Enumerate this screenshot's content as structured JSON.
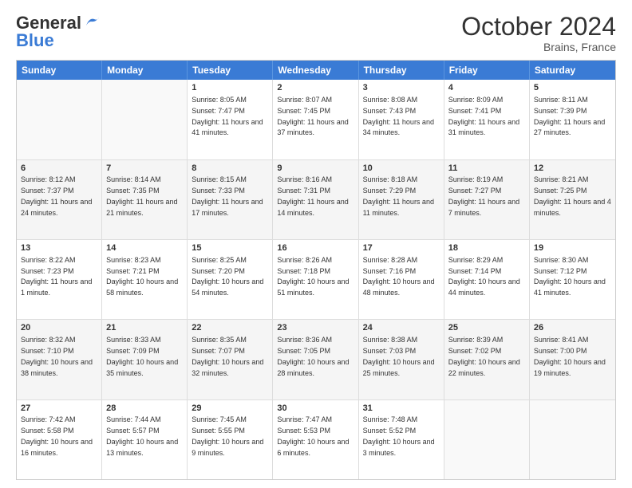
{
  "header": {
    "logo_line1": "General",
    "logo_line2": "Blue",
    "month": "October 2024",
    "location": "Brains, France"
  },
  "weekdays": [
    "Sunday",
    "Monday",
    "Tuesday",
    "Wednesday",
    "Thursday",
    "Friday",
    "Saturday"
  ],
  "rows": [
    [
      {
        "day": "",
        "text": ""
      },
      {
        "day": "",
        "text": ""
      },
      {
        "day": "1",
        "text": "Sunrise: 8:05 AM\nSunset: 7:47 PM\nDaylight: 11 hours and 41 minutes."
      },
      {
        "day": "2",
        "text": "Sunrise: 8:07 AM\nSunset: 7:45 PM\nDaylight: 11 hours and 37 minutes."
      },
      {
        "day": "3",
        "text": "Sunrise: 8:08 AM\nSunset: 7:43 PM\nDaylight: 11 hours and 34 minutes."
      },
      {
        "day": "4",
        "text": "Sunrise: 8:09 AM\nSunset: 7:41 PM\nDaylight: 11 hours and 31 minutes."
      },
      {
        "day": "5",
        "text": "Sunrise: 8:11 AM\nSunset: 7:39 PM\nDaylight: 11 hours and 27 minutes."
      }
    ],
    [
      {
        "day": "6",
        "text": "Sunrise: 8:12 AM\nSunset: 7:37 PM\nDaylight: 11 hours and 24 minutes."
      },
      {
        "day": "7",
        "text": "Sunrise: 8:14 AM\nSunset: 7:35 PM\nDaylight: 11 hours and 21 minutes."
      },
      {
        "day": "8",
        "text": "Sunrise: 8:15 AM\nSunset: 7:33 PM\nDaylight: 11 hours and 17 minutes."
      },
      {
        "day": "9",
        "text": "Sunrise: 8:16 AM\nSunset: 7:31 PM\nDaylight: 11 hours and 14 minutes."
      },
      {
        "day": "10",
        "text": "Sunrise: 8:18 AM\nSunset: 7:29 PM\nDaylight: 11 hours and 11 minutes."
      },
      {
        "day": "11",
        "text": "Sunrise: 8:19 AM\nSunset: 7:27 PM\nDaylight: 11 hours and 7 minutes."
      },
      {
        "day": "12",
        "text": "Sunrise: 8:21 AM\nSunset: 7:25 PM\nDaylight: 11 hours and 4 minutes."
      }
    ],
    [
      {
        "day": "13",
        "text": "Sunrise: 8:22 AM\nSunset: 7:23 PM\nDaylight: 11 hours and 1 minute."
      },
      {
        "day": "14",
        "text": "Sunrise: 8:23 AM\nSunset: 7:21 PM\nDaylight: 10 hours and 58 minutes."
      },
      {
        "day": "15",
        "text": "Sunrise: 8:25 AM\nSunset: 7:20 PM\nDaylight: 10 hours and 54 minutes."
      },
      {
        "day": "16",
        "text": "Sunrise: 8:26 AM\nSunset: 7:18 PM\nDaylight: 10 hours and 51 minutes."
      },
      {
        "day": "17",
        "text": "Sunrise: 8:28 AM\nSunset: 7:16 PM\nDaylight: 10 hours and 48 minutes."
      },
      {
        "day": "18",
        "text": "Sunrise: 8:29 AM\nSunset: 7:14 PM\nDaylight: 10 hours and 44 minutes."
      },
      {
        "day": "19",
        "text": "Sunrise: 8:30 AM\nSunset: 7:12 PM\nDaylight: 10 hours and 41 minutes."
      }
    ],
    [
      {
        "day": "20",
        "text": "Sunrise: 8:32 AM\nSunset: 7:10 PM\nDaylight: 10 hours and 38 minutes."
      },
      {
        "day": "21",
        "text": "Sunrise: 8:33 AM\nSunset: 7:09 PM\nDaylight: 10 hours and 35 minutes."
      },
      {
        "day": "22",
        "text": "Sunrise: 8:35 AM\nSunset: 7:07 PM\nDaylight: 10 hours and 32 minutes."
      },
      {
        "day": "23",
        "text": "Sunrise: 8:36 AM\nSunset: 7:05 PM\nDaylight: 10 hours and 28 minutes."
      },
      {
        "day": "24",
        "text": "Sunrise: 8:38 AM\nSunset: 7:03 PM\nDaylight: 10 hours and 25 minutes."
      },
      {
        "day": "25",
        "text": "Sunrise: 8:39 AM\nSunset: 7:02 PM\nDaylight: 10 hours and 22 minutes."
      },
      {
        "day": "26",
        "text": "Sunrise: 8:41 AM\nSunset: 7:00 PM\nDaylight: 10 hours and 19 minutes."
      }
    ],
    [
      {
        "day": "27",
        "text": "Sunrise: 7:42 AM\nSunset: 5:58 PM\nDaylight: 10 hours and 16 minutes."
      },
      {
        "day": "28",
        "text": "Sunrise: 7:44 AM\nSunset: 5:57 PM\nDaylight: 10 hours and 13 minutes."
      },
      {
        "day": "29",
        "text": "Sunrise: 7:45 AM\nSunset: 5:55 PM\nDaylight: 10 hours and 9 minutes."
      },
      {
        "day": "30",
        "text": "Sunrise: 7:47 AM\nSunset: 5:53 PM\nDaylight: 10 hours and 6 minutes."
      },
      {
        "day": "31",
        "text": "Sunrise: 7:48 AM\nSunset: 5:52 PM\nDaylight: 10 hours and 3 minutes."
      },
      {
        "day": "",
        "text": ""
      },
      {
        "day": "",
        "text": ""
      }
    ]
  ]
}
